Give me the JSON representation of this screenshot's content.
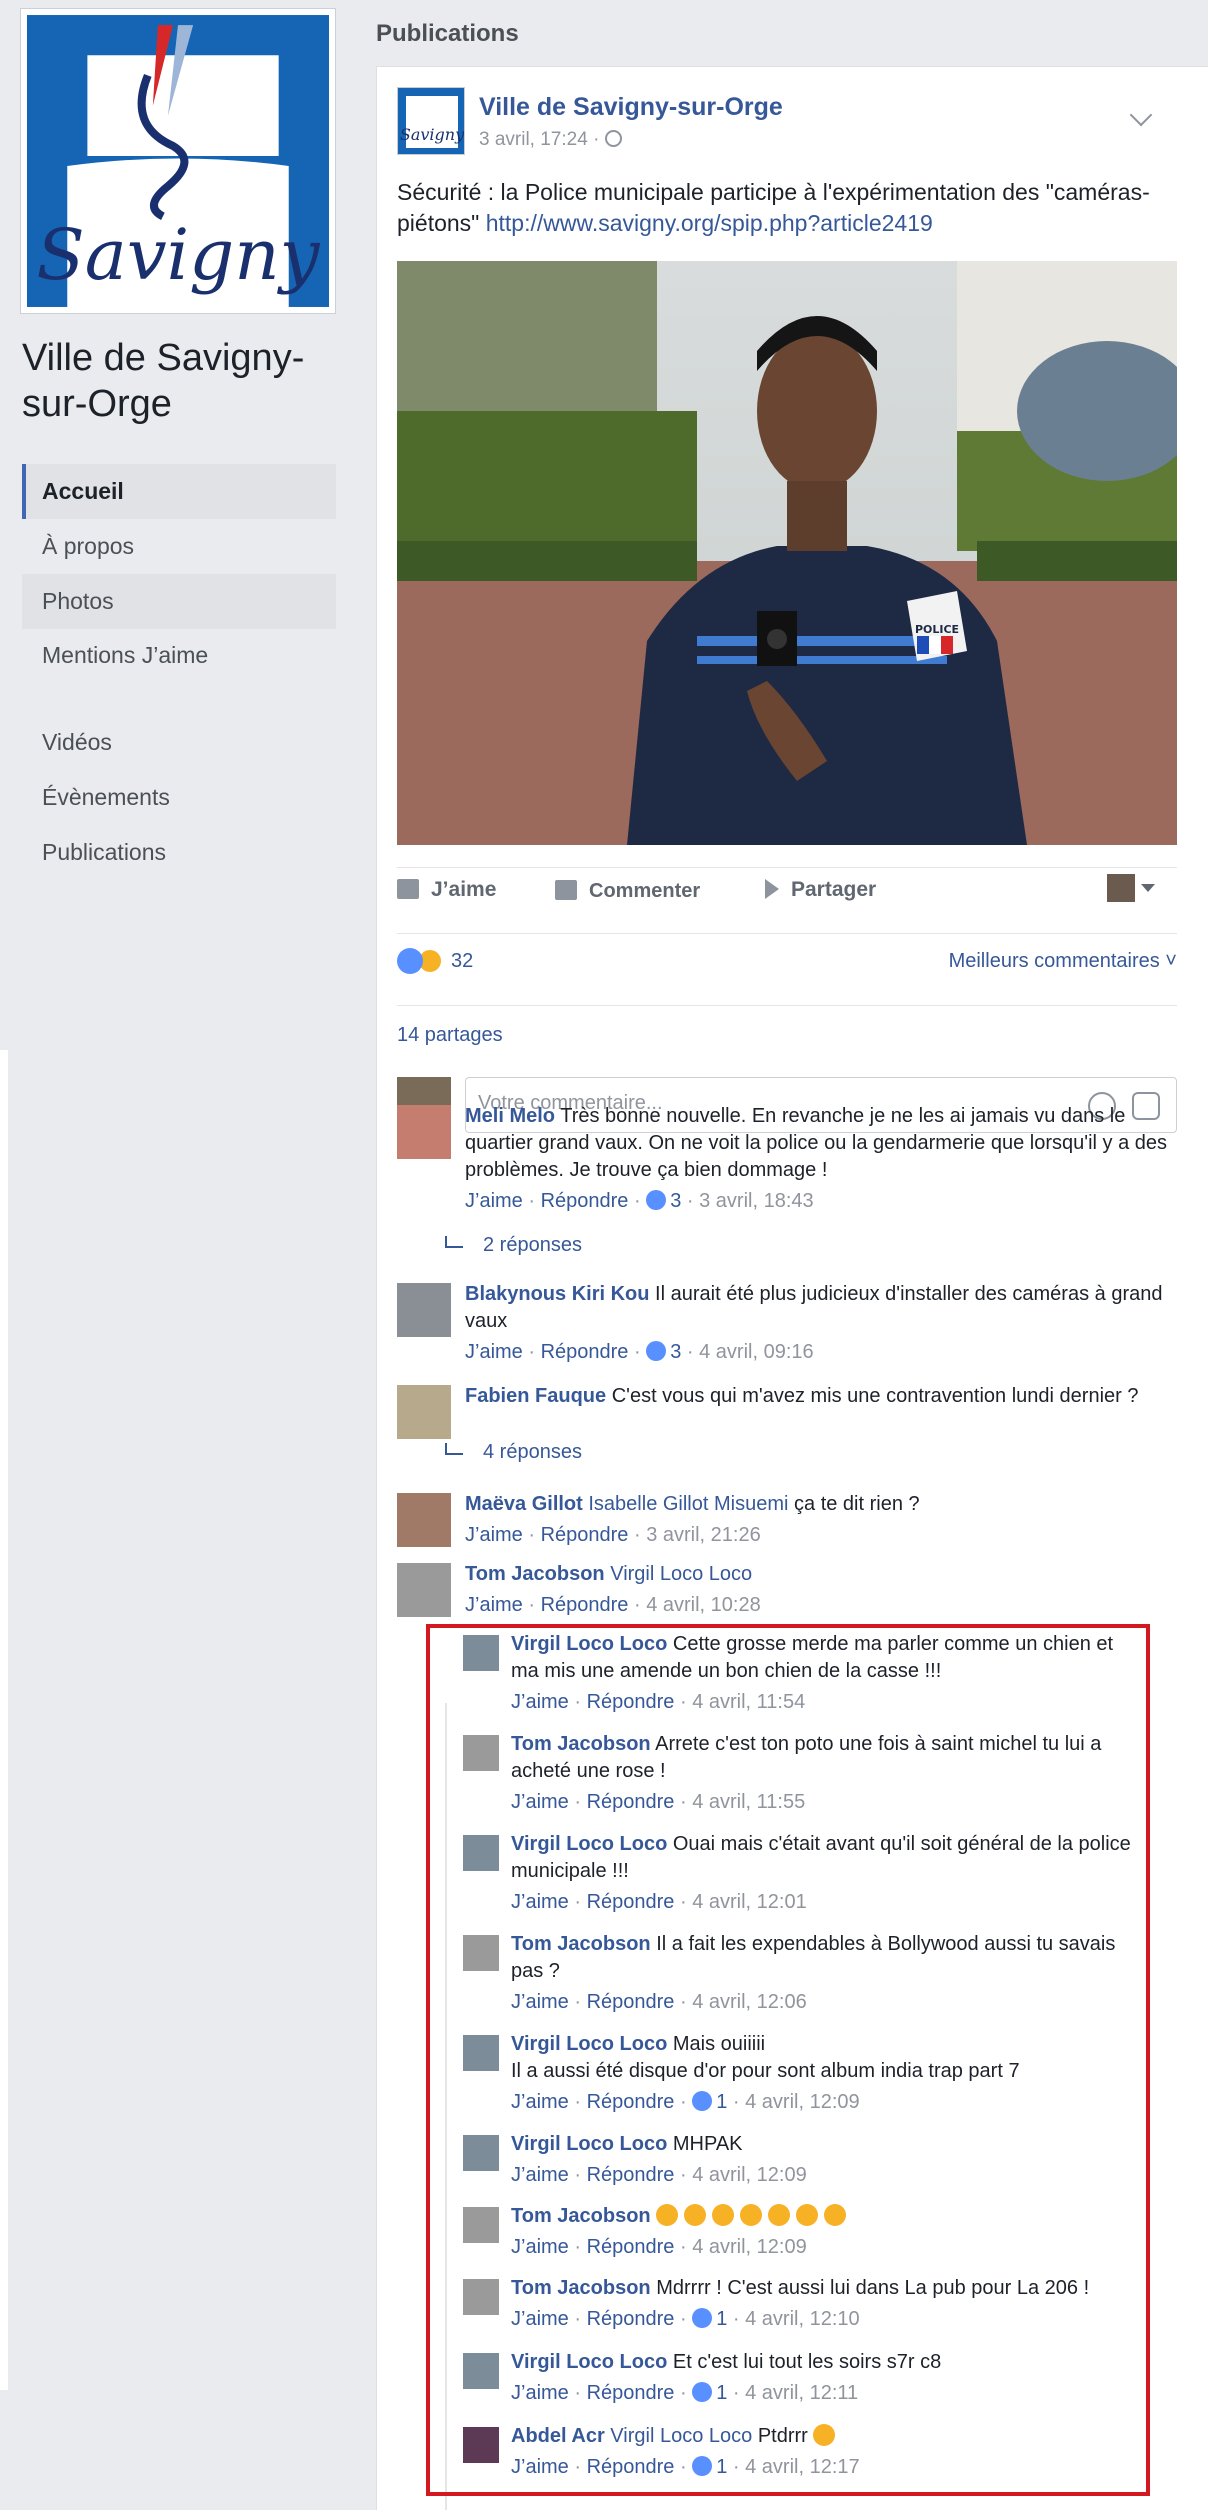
{
  "page": {
    "name": "Ville de Savigny-sur-Orge",
    "logo_text": "Savigny",
    "nav": [
      {
        "label": "Accueil"
      },
      {
        "label": "À propos"
      },
      {
        "label": "Photos"
      },
      {
        "label": "Mentions J’aime"
      },
      {
        "label": "Vidéos"
      },
      {
        "label": "Évènements"
      },
      {
        "label": "Publications"
      }
    ]
  },
  "feed": {
    "section_title": "Publications"
  },
  "post": {
    "author": "Ville de Savigny-sur-Orge",
    "date": "3 avril, 17:24 ·",
    "text": "Sécurité : la Police municipale participe à l'expérimentation des \"caméras-piétons\"",
    "link": "http://www.savigny.org/spip.php?article2419",
    "photo_badge": "POLICE",
    "actions": {
      "like": "J’aime",
      "comment": "Commenter",
      "share": "Partager"
    },
    "reaction_count": "32",
    "sort_label": "Meilleurs commentaires ˅",
    "shares": "14 partages",
    "comment_placeholder": "Votre commentaire..."
  },
  "ui": {
    "like": "J’aime",
    "reply": "Répondre",
    "sep": " · "
  },
  "comments": [
    {
      "name": "Meli Melo",
      "text": "Très bonne nouvelle. En revanche je ne les ai jamais vu dans le quartier grand vaux. On ne voit la police ou la gendarmerie que lorsqu'il y a des problèmes. Je trouve ça bien dommage !",
      "likes": "3",
      "time": "3 avril, 18:43",
      "replies": "2 réponses"
    },
    {
      "name": "Blakynous Kiri Kou",
      "text": "Il aurait été plus judicieux d'installer des caméras à grand vaux",
      "likes": "3",
      "time": "4 avril, 09:16"
    },
    {
      "name": "Fabien Fauque",
      "text": "C'est vous qui m'avez mis une contravention lundi dernier ?",
      "replies": "4 réponses"
    },
    {
      "name": "Maëva Gillot",
      "tag": "Isabelle Gillot Misuemi",
      "text": "ça te dit rien ?",
      "time": "3 avril, 21:26"
    },
    {
      "name": "Tom Jacobson",
      "tag": "Virgil Loco Loco",
      "text": "",
      "time": "4 avril, 10:28"
    }
  ],
  "replies": [
    {
      "name": "Virgil Loco Loco",
      "text": "Cette grosse merde ma parler comme un chien et ma mis une amende un bon chien de la casse !!!",
      "time": "4 avril, 11:54"
    },
    {
      "name": "Tom Jacobson",
      "text": "Arrete c'est ton poto une fois à saint michel tu lui a acheté une rose !",
      "time": "4 avril, 11:55"
    },
    {
      "name": "Virgil Loco Loco",
      "text": "Ouai mais c'était avant qu'il soit général de la police municipale !!!",
      "time": "4 avril, 12:01"
    },
    {
      "name": "Tom Jacobson",
      "text": "Il a fait les expendables à Bollywood aussi tu savais pas ?",
      "time": "4 avril, 12:06"
    },
    {
      "name": "Virgil Loco Loco",
      "text": "Mais ouiiiii",
      "text2": "Il a aussi été disque d'or pour sont album india trap part 7",
      "likes": "1",
      "time": "4 avril, 12:09"
    },
    {
      "name": "Virgil Loco Loco",
      "text": "MHPAK",
      "time": "4 avril, 12:09"
    },
    {
      "name": "Tom Jacobson",
      "text": "",
      "emoji_count": 7,
      "time": "4 avril, 12:09"
    },
    {
      "name": "Tom Jacobson",
      "text": "Mdrrrr ! C'est aussi lui dans La pub pour La 206 !",
      "likes": "1",
      "time": "4 avril, 12:10"
    },
    {
      "name": "Virgil Loco Loco",
      "text": "Et c'est lui tout les soirs s7r c8",
      "likes": "1",
      "time": "4 avril, 12:11"
    },
    {
      "name": "Abdel Acr",
      "tag": "Virgil Loco Loco",
      "text": "Ptdrrr",
      "emoji_count": 1,
      "likes": "1",
      "time": "4 avril, 12:17"
    }
  ],
  "colors": {
    "link": "#365899",
    "highlight_box": "#d3191f",
    "facebook_blue": "#4267b2"
  }
}
